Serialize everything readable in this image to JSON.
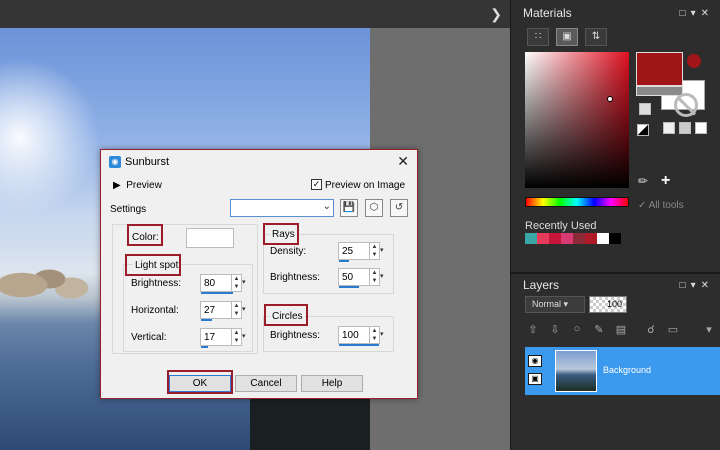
{
  "canvas": {
    "collapse_icon": "chevron-right-icon"
  },
  "materials": {
    "title": "Materials",
    "tabs": [
      "swatches-icon",
      "rainbow-icon",
      "adjust-icon"
    ],
    "all_tools": "All tools",
    "recently_used_label": "Recently Used",
    "recent_colors": [
      "#3aa6a6",
      "#e83a5a",
      "#c8163a",
      "#d93a74",
      "#8c2a3a",
      "#b01a28",
      "#ffffff",
      "#000000"
    ],
    "main_color": "#a01517"
  },
  "layers": {
    "title": "Layers",
    "blend_mode": "Normal",
    "opacity": "100",
    "layer_name": "Background"
  },
  "dialog": {
    "title": "Sunburst",
    "preview_label": "Preview",
    "preview_on_image_label": "Preview on Image",
    "preview_on_image_checked": true,
    "settings_label": "Settings",
    "settings_value": "",
    "color_label": "Color:",
    "light_spot_label": "Light spot",
    "brightness_label": "Brightness:",
    "brightness_value": "80",
    "horizontal_label": "Horizontal:",
    "horizontal_value": "27",
    "vertical_label": "Vertical:",
    "vertical_value": "17",
    "rays_label": "Rays",
    "density_label": "Density:",
    "density_value": "25",
    "rays_brightness_label": "Brightness:",
    "rays_brightness_value": "50",
    "circles_label": "Circles",
    "circles_brightness_label": "Brightness:",
    "circles_brightness_value": "100",
    "ok_label": "OK",
    "cancel_label": "Cancel",
    "help_label": "Help"
  }
}
